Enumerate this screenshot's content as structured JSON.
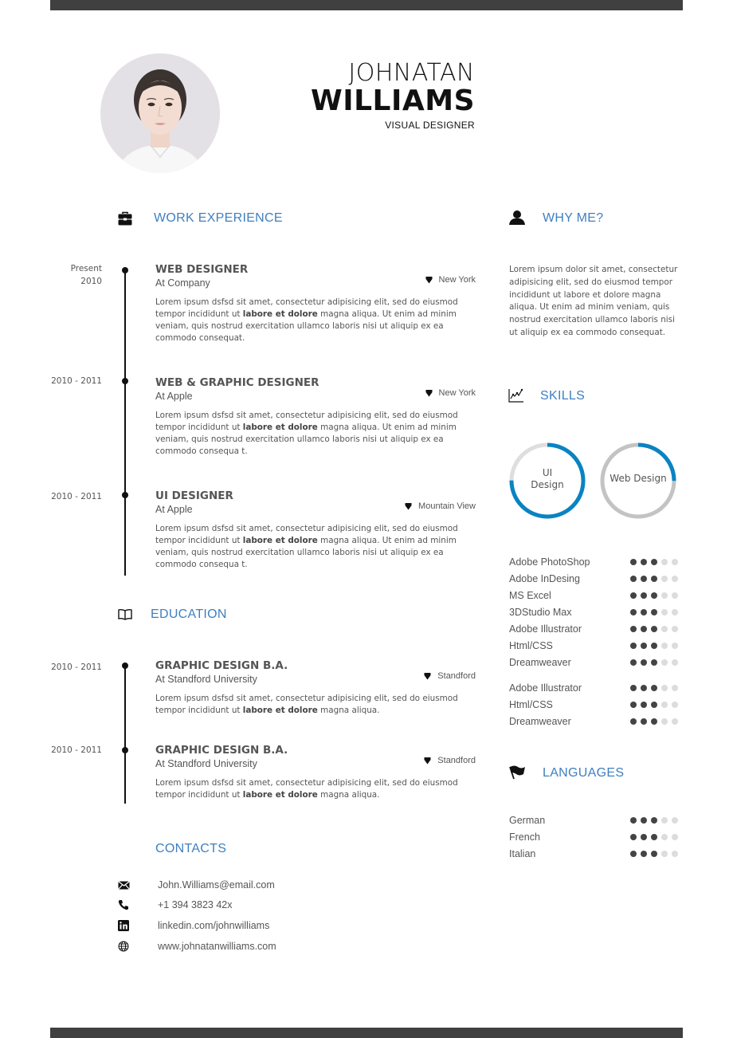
{
  "header": {
    "first_name": "JOHNATAN",
    "last_name": "WILLIAMS",
    "job_title": "VISUAL DESIGNER"
  },
  "avatar": {
    "icon": "profile-photo",
    "background": "#e4e1e6"
  },
  "colors": {
    "accent": "#3f7fc0",
    "ring_fill": "#0a83c2",
    "bar": "#404040",
    "dot_on": "#444444",
    "dot_off": "#dcdcdc"
  },
  "work_experience": {
    "title": "WORK EXPERIENCE",
    "icon": "briefcase-icon",
    "items": [
      {
        "date_line1": "Present",
        "date_line2": "2010",
        "role": "WEB DESIGNER",
        "org": "At Company",
        "location": "New York",
        "desc_pre": "Lorem ipsum dsfsd sit amet, consectetur adipisicing elit, sed do eiusmod tempor incididunt ut ",
        "desc_bold": "labore et dolore",
        "desc_post": " magna aliqua. Ut enim ad minim veniam, quis nostrud exercitation ullamco laboris nisi ut aliquip ex ea commodo consequat."
      },
      {
        "date_line1": "2010 - 2011",
        "date_line2": "",
        "role": "WEB & GRAPHIC DESIGNER",
        "org": "At Apple",
        "location": "New York",
        "desc_pre": "Lorem ipsum dsfsd sit amet, consectetur adipisicing elit, sed do eiusmod tempor incididunt ut ",
        "desc_bold": "labore et dolore",
        "desc_post": " magna aliqua. Ut enim ad minim veniam, quis nostrud exercitation ullamco laboris nisi ut aliquip ex ea commodo consequa t."
      },
      {
        "date_line1": "2010 - 2011",
        "date_line2": "",
        "role": "UI DESIGNER",
        "org": "At Apple",
        "location": "Mountain View",
        "desc_pre": "Lorem ipsum dsfsd sit amet, consectetur adipisicing elit, sed do eiusmod tempor incididunt ut ",
        "desc_bold": "labore et dolore",
        "desc_post": " magna aliqua. Ut enim ad minim veniam, quis nostrud exercitation ullamco laboris nisi ut aliquip ex ea commodo consequa t."
      }
    ]
  },
  "education": {
    "title": "EDUCATION",
    "icon": "book-icon",
    "items": [
      {
        "date_line1": "2010 - 2011",
        "role": "GRAPHIC DESIGN B.A.",
        "org": "At Standford University",
        "location": "Standford",
        "desc_pre": "Lorem ipsum dsfsd sit amet, consectetur adipisicing elit, sed do eiusmod tempor incididunt ut ",
        "desc_bold": "labore et dolore",
        "desc_post": " magna aliqua."
      },
      {
        "date_line1": "2010 - 2011",
        "role": "GRAPHIC DESIGN B.A.",
        "org": "At Standford University",
        "location": "Standford",
        "desc_pre": "Lorem ipsum dsfsd sit amet, consectetur adipisicing elit, sed do eiusmod tempor incididunt ut ",
        "desc_bold": "labore et dolore",
        "desc_post": " magna aliqua."
      }
    ]
  },
  "contacts": {
    "title": "CONTACTS",
    "items": [
      {
        "icon": "envelope-icon",
        "text": "John.Williams@email.com"
      },
      {
        "icon": "phone-icon",
        "text": "+1 394 3823 42x"
      },
      {
        "icon": "linkedin-icon",
        "text": "linkedin.com/johnwilliams"
      },
      {
        "icon": "globe-icon",
        "text": "www.johnatanwilliams.com"
      }
    ]
  },
  "why_me": {
    "title": "WHY ME?",
    "icon": "user-icon",
    "text": "Lorem ipsum dolor sit amet, consectetur adipisicing elit, sed do eiusmod tempor incididunt ut labore et dolore magna aliqua. Ut enim ad minim veniam, quis nostrud exercitation ullamco laboris nisi ut aliquip ex ea commodo consequat."
  },
  "skills": {
    "title": "SKILLS",
    "icon": "line-chart-icon",
    "rings": [
      {
        "label_line1": "UI",
        "label_line2": "Design",
        "percent": 75,
        "track": "#dedede"
      },
      {
        "label_line1": "Web Design",
        "label_line2": "",
        "percent": 25,
        "track": "#c3c3c3"
      }
    ],
    "max_level": 5,
    "list": [
      {
        "name": "Adobe PhotoShop",
        "level": 3
      },
      {
        "name": "Adobe InDesing",
        "level": 3
      },
      {
        "name": "MS Excel",
        "level": 3
      },
      {
        "name": "3DStudio Max",
        "level": 3
      },
      {
        "name": "Adobe Illustrator",
        "level": 3
      },
      {
        "name": "Html/CSS",
        "level": 3
      },
      {
        "name": "Dreamweaver",
        "level": 3
      },
      {
        "name": "Adobe Illustrator",
        "level": 3
      },
      {
        "name": "Html/CSS",
        "level": 3
      },
      {
        "name": "Dreamweaver",
        "level": 3
      }
    ]
  },
  "languages": {
    "title": "LANGUAGES",
    "icon": "flag-icon",
    "max_level": 5,
    "list": [
      {
        "name": "German",
        "level": 3
      },
      {
        "name": "French",
        "level": 3
      },
      {
        "name": "Italian",
        "level": 3
      }
    ]
  }
}
